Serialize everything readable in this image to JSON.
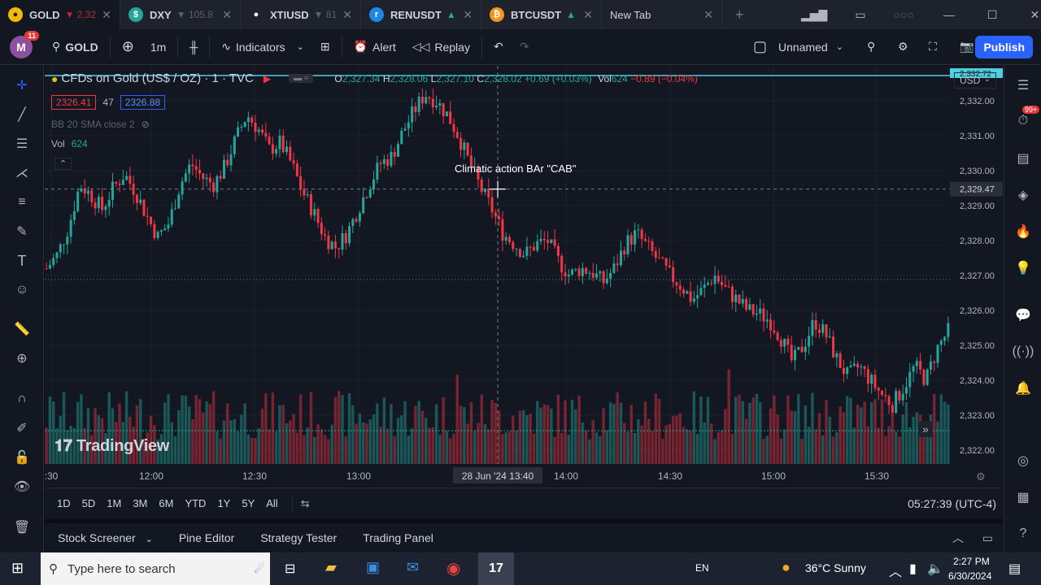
{
  "browser_tabs": [
    {
      "symbol": "GOLD",
      "price": "▼ 2,32",
      "icon_color": "#f0b90b",
      "icon": "coin-icon",
      "active": true
    },
    {
      "symbol": "DXY",
      "price": "▼ 105.8",
      "icon_color": "#26a69a",
      "icon": "dollar-icon",
      "active": false
    },
    {
      "symbol": "XTIUSD",
      "price": "▼ 81",
      "icon_color": "#ffffff",
      "icon": "oil-drop-icon",
      "active": false
    },
    {
      "symbol": "RENUSDT",
      "price": "▲",
      "icon_color": "#1e88e5",
      "icon": "ren-icon",
      "active": false
    },
    {
      "symbol": "BTCUSDT",
      "price": "▲",
      "icon_color": "#f7931a",
      "icon": "bitcoin-icon",
      "active": false
    },
    {
      "symbol": "New Tab",
      "price": "",
      "icon_color": "",
      "icon": "",
      "active": false
    }
  ],
  "toolbar": {
    "avatar_letter": "M",
    "avatar_badge": "11",
    "symbol": "GOLD",
    "interval": "1m",
    "indicators": "Indicators",
    "alert": "Alert",
    "replay": "Replay",
    "layout_name": "Unnamed",
    "publish": "Publish"
  },
  "legend": {
    "title": "CFDs on Gold (US$ / OZ) · 1 · TVC",
    "o_label": "O",
    "o": "2,327.34",
    "h_label": "H",
    "h": "2,328.06",
    "l_label": "L",
    "l": "2,327.10",
    "c_label": "C",
    "c": "2,328.02",
    "change": "+0.69 (+0.03%)",
    "vol_label": "Vol",
    "vol": "624",
    "vol_change": "−0.89 (−0.04%)",
    "bid": "2326.41",
    "spread": "47",
    "ask": "2326.88",
    "bb_label": "BB 20 SMA close 2",
    "vol_ind_label": "Vol",
    "vol_ind_value": "624"
  },
  "currency": "USD",
  "annotation": "Climatic action BAr \"CAB\"",
  "watermark": "TradingView",
  "chart_data": {
    "type": "candlestick",
    "x_ticks": [
      ":30",
      "12:00",
      "12:30",
      "13:00",
      "14:00",
      "14:30",
      "15:00",
      "15:30"
    ],
    "crosshair_time": "28 Jun '24  13:40",
    "y_ticks": [
      "2,332.00",
      "2,331.00",
      "2,330.00",
      "2,329.00",
      "2,328.00",
      "2,327.00",
      "2,326.00",
      "2,325.00",
      "2,324.00",
      "2,323.00",
      "2,322.00"
    ],
    "y_tick_values": [
      2332,
      2331,
      2330,
      2329,
      2328,
      2327,
      2326,
      2325,
      2324,
      2323,
      2322
    ],
    "crosshair_price": "2,329.47",
    "crosshair_price_value": 2329.47,
    "top_price_label": "2,332.72",
    "top_price_value": 2332.72,
    "ylim": [
      2321.6,
      2333.0
    ],
    "close_path": [
      2327.2,
      2327.6,
      2328.4,
      2329.6,
      2329.3,
      2328.9,
      2329.5,
      2329.9,
      2329.4,
      2328.7,
      2328.1,
      2328.5,
      2329.6,
      2330.2,
      2329.8,
      2329.6,
      2330.1,
      2330.9,
      2331.6,
      2331.2,
      2330.6,
      2330.8,
      2330.2,
      2329.4,
      2328.8,
      2328.1,
      2327.8,
      2328.2,
      2328.9,
      2329.6,
      2330.2,
      2330.4,
      2331.1,
      2331.7,
      2332.2,
      2332.0,
      2331.6,
      2331.0,
      2330.2,
      2329.5,
      2328.9,
      2328.2,
      2327.9,
      2327.6,
      2327.9,
      2328.0,
      2327.4,
      2327.0,
      2327.2,
      2327.1,
      2326.8,
      2327.2,
      2327.9,
      2328.2,
      2327.8,
      2327.4,
      2327.0,
      2326.7,
      2326.3,
      2326.6,
      2327.0,
      2326.6,
      2326.3,
      2326.0,
      2325.9,
      2325.7,
      2325.2,
      2324.5,
      2325.0,
      2325.7,
      2325.3,
      2324.6,
      2324.1,
      2324.4,
      2324.0,
      2323.6,
      2323.3,
      2323.8,
      2324.4,
      2324.0,
      2324.9,
      2325.4
    ],
    "series": [
      {
        "name": "Volume",
        "approx_range": [
          0,
          1000
        ]
      }
    ]
  },
  "range_buttons": [
    "1D",
    "5D",
    "1M",
    "3M",
    "6M",
    "YTD",
    "1Y",
    "5Y",
    "All"
  ],
  "clock": "05:27:39 (UTC-4)",
  "panels": [
    "Stock Screener",
    "Pine Editor",
    "Strategy Tester",
    "Trading Panel"
  ],
  "right_badge": "99+",
  "taskbar": {
    "search_placeholder": "Type here to search",
    "lang": "EN",
    "weather": "36°C  Sunny",
    "time": "2:27 PM",
    "date": "6/30/2024"
  },
  "colors": {
    "up": "#26a69a",
    "down": "#f23645",
    "accent": "#2962ff",
    "bg": "#131722"
  }
}
